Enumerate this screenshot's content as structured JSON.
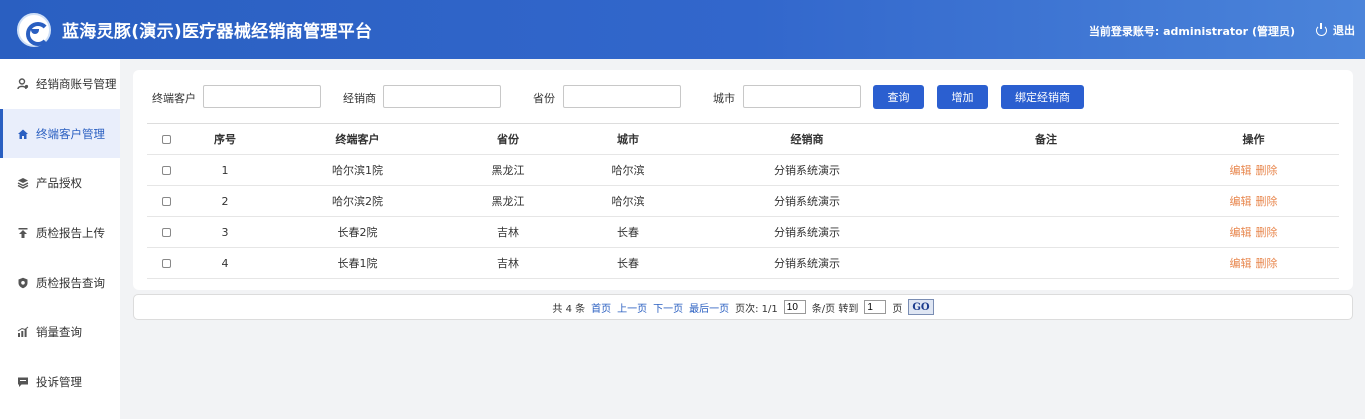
{
  "header": {
    "title": "蓝海灵豚(演示)医疗器械经销商管理平台",
    "user_label": "当前登录账号: administrator (管理员)",
    "logout_label": "退出"
  },
  "sidebar": {
    "items": [
      {
        "label": "经销商账号管理",
        "icon": "user-gear-icon"
      },
      {
        "label": "终端客户管理",
        "icon": "home-icon"
      },
      {
        "label": "产品授权",
        "icon": "layers-icon"
      },
      {
        "label": "质检报告上传",
        "icon": "upload-icon"
      },
      {
        "label": "质检报告查询",
        "icon": "shield-icon"
      },
      {
        "label": "销量查询",
        "icon": "bar-chart-icon"
      },
      {
        "label": "投诉管理",
        "icon": "message-icon"
      }
    ],
    "active_index": 1
  },
  "search": {
    "customer_label": "终端客户",
    "dealer_label": "经销商",
    "province_label": "省份",
    "city_label": "城市",
    "query_button": "查询",
    "add_button": "增加",
    "bind_button": "绑定经销商"
  },
  "table": {
    "columns": [
      "序号",
      "终端客户",
      "省份",
      "城市",
      "经销商",
      "备注",
      "操作"
    ],
    "rows": [
      {
        "no": "1",
        "customer": "哈尔滨1院",
        "province": "黑龙江",
        "city": "哈尔滨",
        "dealer": "分销系统演示",
        "note": ""
      },
      {
        "no": "2",
        "customer": "哈尔滨2院",
        "province": "黑龙江",
        "city": "哈尔滨",
        "dealer": "分销系统演示",
        "note": ""
      },
      {
        "no": "3",
        "customer": "长春2院",
        "province": "吉林",
        "city": "长春",
        "dealer": "分销系统演示",
        "note": ""
      },
      {
        "no": "4",
        "customer": "长春1院",
        "province": "吉林",
        "city": "长春",
        "dealer": "分销系统演示",
        "note": ""
      }
    ],
    "edit_label": "编辑",
    "delete_label": "删除"
  },
  "pager": {
    "total_text": "共 4 条",
    "first": "首页",
    "prev": "上一页",
    "next": "下一页",
    "last": "最后一页",
    "page_info": "页次: 1/1",
    "page_size": "10",
    "per_page_text": "条/页 转到",
    "goto_value": "1",
    "page_suffix": "页",
    "go_label": "GO"
  },
  "colors": {
    "primary": "#2b5fd0",
    "header_start": "#2a5fc1",
    "header_end": "#4b84da",
    "action_link": "#e8874e"
  }
}
